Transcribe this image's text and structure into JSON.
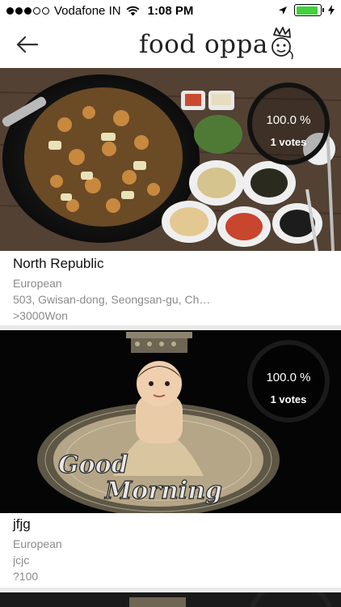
{
  "status_bar": {
    "carrier": "Vodafone IN",
    "time": "1:08 PM",
    "signal_dots_filled": 3,
    "signal_dots_total": 5,
    "battery_level": 0.9,
    "battery_color": "#3fd23a"
  },
  "nav": {
    "logo_text": "food oppa"
  },
  "restaurants": [
    {
      "name": "North Republic",
      "cuisine": "European",
      "address": "503, Gwisan-dong, Seongsan-gu, Ch…",
      "price": ">3000Won",
      "rating_percent": "100.0 %",
      "votes": "1 votes",
      "image": "food-photo"
    },
    {
      "name": "jfjg",
      "cuisine": "European",
      "address": "jcjc",
      "price": "?100",
      "rating_percent": "100.0 %",
      "votes": "1 votes",
      "image": "baby-photo",
      "image_caption_line1": "Good",
      "image_caption_line2": "Morning"
    }
  ],
  "colors": {
    "accent_ring": "#111111",
    "divider": "#e9e9e9",
    "meta_text": "#8a8a8a"
  }
}
